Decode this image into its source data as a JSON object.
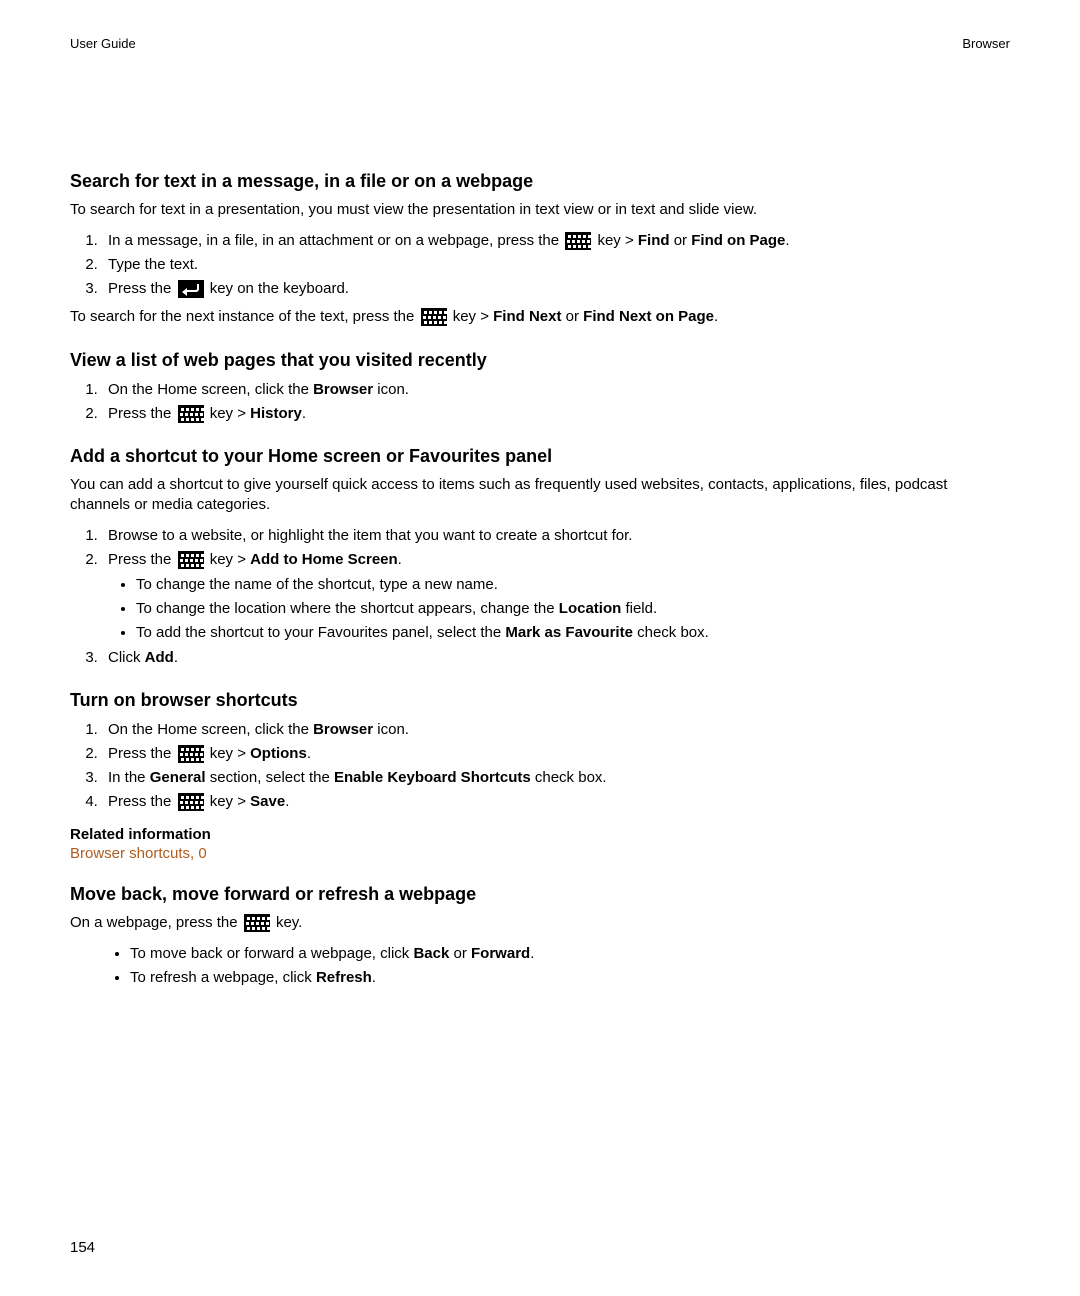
{
  "header": {
    "left": "User Guide",
    "right": "Browser"
  },
  "s1": {
    "title": "Search for text in a message, in a file or on a webpage",
    "intro": "To search for text in a presentation, you must view the presentation in text view or in text and slide view.",
    "li1_a": "In a message, in a file, in an attachment or on a webpage, press the ",
    "li1_b": " key > ",
    "li1_find": "Find",
    "li1_or": " or ",
    "li1_fop": "Find on Page",
    "li1_dot": ".",
    "li2": "Type the text.",
    "li3_a": "Press the ",
    "li3_b": " key on the keyboard.",
    "out_a": "To search for the next instance of the text, press the ",
    "out_b": " key > ",
    "out_fn": "Find Next",
    "out_or": " or ",
    "out_fnop": "Find Next on Page",
    "out_dot": "."
  },
  "s2": {
    "title": "View a list of web pages that you visited recently",
    "li1_a": "On the Home screen, click the ",
    "li1_browser": "Browser",
    "li1_b": " icon.",
    "li2_a": "Press the ",
    "li2_b": " key > ",
    "li2_history": "History",
    "li2_dot": "."
  },
  "s3": {
    "title": "Add a shortcut to your Home screen or Favourites panel",
    "intro": "You can add a shortcut to give yourself quick access to items such as frequently used websites, contacts, applications, files, podcast channels or media categories.",
    "li1": "Browse to a website, or highlight the item that you want to create a shortcut for.",
    "li2_a": "Press the ",
    "li2_b": " key > ",
    "li2_add": "Add to Home Screen",
    "li2_dot": ".",
    "b1": "To change the name of the shortcut, type a new name.",
    "b2_a": "To change the location where the shortcut appears, change the ",
    "b2_loc": "Location",
    "b2_b": " field.",
    "b3_a": "To add the shortcut to your Favourites panel, select the ",
    "b3_mark": "Mark as Favourite",
    "b3_b": " check box.",
    "li3_a": "Click ",
    "li3_add": "Add",
    "li3_dot": "."
  },
  "s4": {
    "title": "Turn on browser shortcuts",
    "li1_a": "On the Home screen, click the ",
    "li1_browser": "Browser",
    "li1_b": " icon.",
    "li2_a": "Press the ",
    "li2_b": " key > ",
    "li2_options": "Options",
    "li2_dot": ".",
    "li3_a": "In the ",
    "li3_general": "General",
    "li3_b": " section, select the ",
    "li3_eks": "Enable Keyboard Shortcuts",
    "li3_c": " check box.",
    "li4_a": "Press the ",
    "li4_b": " key > ",
    "li4_save": "Save",
    "li4_dot": ".",
    "related_title": "Related information",
    "related_link": "Browser shortcuts,  0"
  },
  "s5": {
    "title": "Move back, move forward or refresh a webpage",
    "intro_a": "On a webpage, press the ",
    "intro_b": " key.",
    "b1_a": "To move back or forward a webpage, click ",
    "b1_back": "Back",
    "b1_or": " or ",
    "b1_fwd": "Forward",
    "b1_dot": ".",
    "b2_a": "To refresh a webpage, click ",
    "b2_refresh": "Refresh",
    "b2_dot": "."
  },
  "page_number": "154"
}
